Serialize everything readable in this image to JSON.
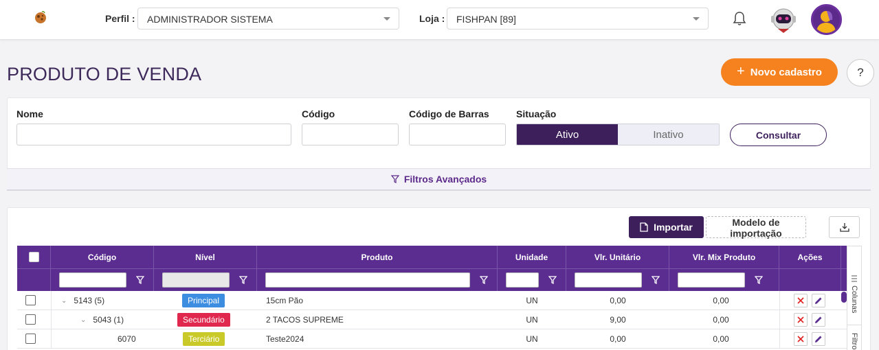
{
  "header": {
    "perfil_label": "Perfil :",
    "perfil_value": "ADMINISTRADOR SISTEMA",
    "loja_label": "Loja :",
    "loja_value": "FISHPAN [89]"
  },
  "page": {
    "title": "PRODUTO DE VENDA",
    "new_button": "Novo cadastro",
    "new_button_icon": "+",
    "help_button": "?"
  },
  "filters": {
    "nome_label": "Nome",
    "codigo_label": "Código",
    "barras_label": "Código de Barras",
    "situacao_label": "Situação",
    "situacao_options": [
      "Ativo",
      "Inativo"
    ],
    "situacao_selected": "Ativo",
    "consultar": "Consultar",
    "advanced": "Filtros Avançados"
  },
  "toolbar": {
    "import": "Importar",
    "modelo": "Modelo de importação"
  },
  "table": {
    "columns": [
      "Código",
      "Nível",
      "Produto",
      "Unidade",
      "Vlr. Unitário",
      "Vlr. Mix Produto",
      "Ações"
    ],
    "rows": [
      {
        "codigo": "5143 (5)",
        "nivel": "Principal",
        "produto": "15cm Pão",
        "unidade": "UN",
        "vlr_unitario": "0,00",
        "vlr_mix": "0,00"
      },
      {
        "codigo": "5043 (1)",
        "nivel": "Secundário",
        "produto": "2 TACOS SUPREME",
        "unidade": "UN",
        "vlr_unitario": "9,00",
        "vlr_mix": "0,00"
      },
      {
        "codigo": "6070",
        "nivel": "Terciário",
        "produto": "Teste2024",
        "unidade": "UN",
        "vlr_unitario": "0,00",
        "vlr_mix": "0,00"
      }
    ],
    "level_colors": {
      "Principal": "#3d8ee0",
      "Secundário": "#e0284f",
      "Terciário": "#c9c92a"
    },
    "side_tabs": [
      "Colunas",
      "Filtros"
    ]
  },
  "colors": {
    "primary": "#5c2d91",
    "dark_primary": "#3d1f5c",
    "accent": "#f5821f"
  }
}
